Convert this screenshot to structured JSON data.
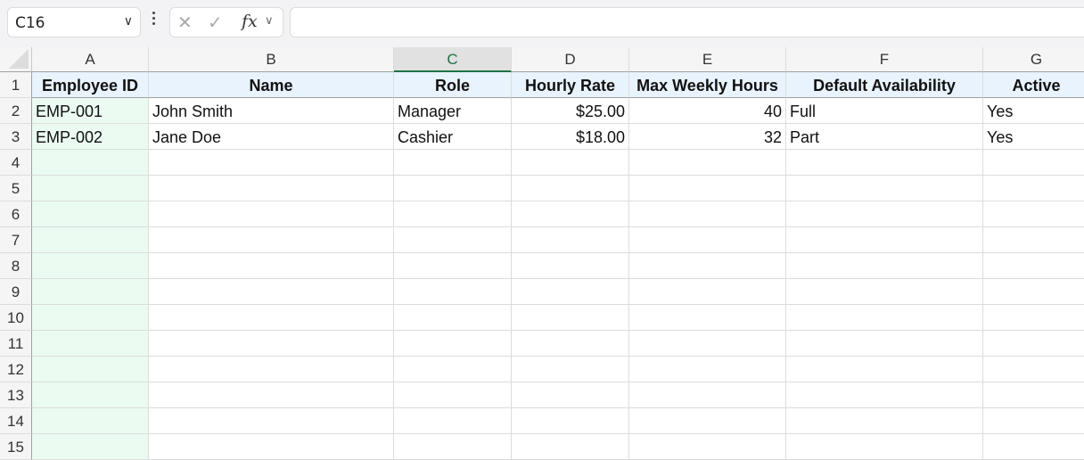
{
  "name_box": {
    "value": "C16"
  },
  "formula_bar": {
    "cancel_icon": "x-icon",
    "enter_icon": "check-icon",
    "fx_label": "fx",
    "value": ""
  },
  "columns": [
    "A",
    "B",
    "C",
    "D",
    "E",
    "F",
    "G"
  ],
  "selected_column": "C",
  "row_numbers": [
    "1",
    "2",
    "3",
    "4",
    "5",
    "6",
    "7",
    "8",
    "9",
    "10",
    "11",
    "12",
    "13",
    "14",
    "15"
  ],
  "headers": [
    "Employee ID",
    "Name",
    "Role",
    "Hourly Rate",
    "Max Weekly Hours",
    "Default Availability",
    "Active"
  ],
  "rows": [
    [
      "EMP-001",
      "John Smith",
      "Manager",
      "$25.00",
      "40",
      "Full",
      "Yes"
    ],
    [
      "EMP-002",
      "Jane Doe",
      "Cashier",
      "$18.00",
      "32",
      "Part",
      "Yes"
    ]
  ],
  "colors": {
    "header_fill": "#e8f3fd",
    "column_a_fill": "#ebfbf2",
    "selection_accent": "#1e7145"
  }
}
